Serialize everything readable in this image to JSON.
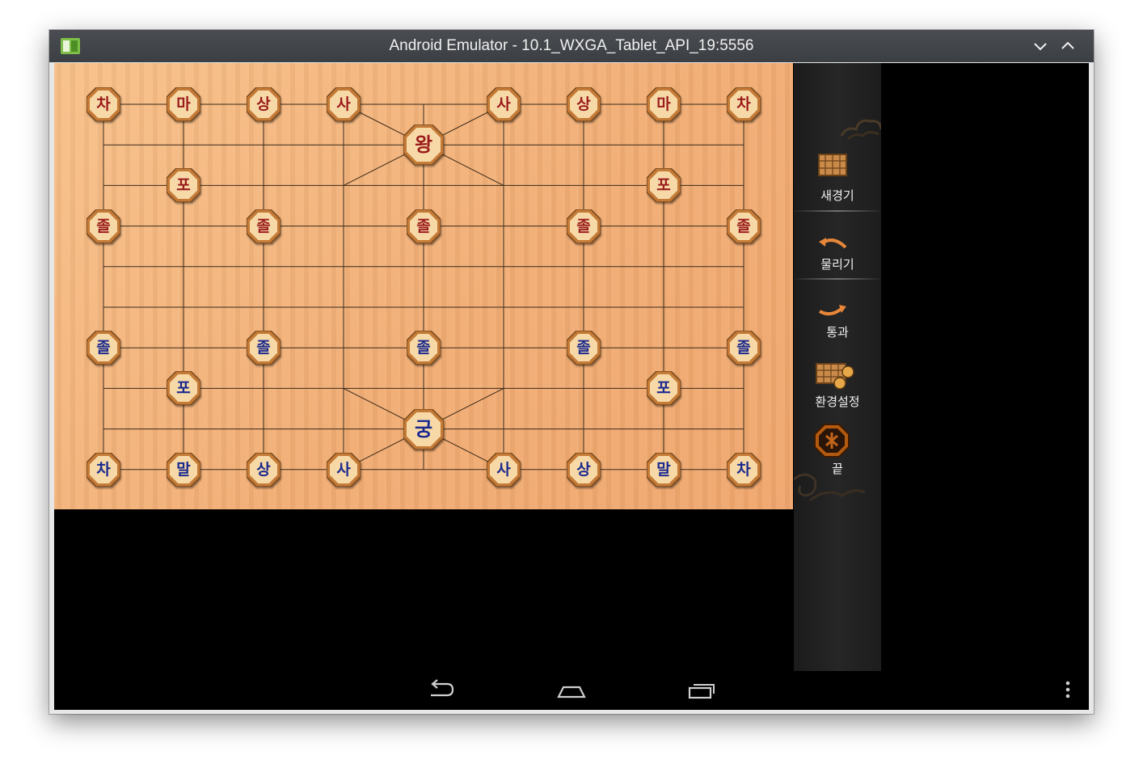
{
  "window": {
    "title": "Android Emulator - 10.1_WXGA_Tablet_API_19:5556"
  },
  "board": {
    "pieces": [
      {
        "label": "차",
        "side": "red",
        "col": 0,
        "row": 0
      },
      {
        "label": "마",
        "side": "red",
        "col": 1,
        "row": 0
      },
      {
        "label": "상",
        "side": "red",
        "col": 2,
        "row": 0
      },
      {
        "label": "사",
        "side": "red",
        "col": 3,
        "row": 0
      },
      {
        "label": "왕",
        "side": "red",
        "col": 4,
        "row": 1,
        "large": true
      },
      {
        "label": "사",
        "side": "red",
        "col": 5,
        "row": 0
      },
      {
        "label": "상",
        "side": "red",
        "col": 6,
        "row": 0
      },
      {
        "label": "마",
        "side": "red",
        "col": 7,
        "row": 0
      },
      {
        "label": "차",
        "side": "red",
        "col": 8,
        "row": 0
      },
      {
        "label": "포",
        "side": "red",
        "col": 1,
        "row": 2
      },
      {
        "label": "포",
        "side": "red",
        "col": 7,
        "row": 2
      },
      {
        "label": "졸",
        "side": "red",
        "col": 0,
        "row": 3
      },
      {
        "label": "졸",
        "side": "red",
        "col": 2,
        "row": 3
      },
      {
        "label": "졸",
        "side": "red",
        "col": 4,
        "row": 3
      },
      {
        "label": "졸",
        "side": "red",
        "col": 6,
        "row": 3
      },
      {
        "label": "졸",
        "side": "red",
        "col": 8,
        "row": 3
      },
      {
        "label": "졸",
        "side": "blue",
        "col": 0,
        "row": 6
      },
      {
        "label": "졸",
        "side": "blue",
        "col": 2,
        "row": 6
      },
      {
        "label": "졸",
        "side": "blue",
        "col": 4,
        "row": 6
      },
      {
        "label": "졸",
        "side": "blue",
        "col": 6,
        "row": 6
      },
      {
        "label": "졸",
        "side": "blue",
        "col": 8,
        "row": 6
      },
      {
        "label": "포",
        "side": "blue",
        "col": 1,
        "row": 7
      },
      {
        "label": "포",
        "side": "blue",
        "col": 7,
        "row": 7
      },
      {
        "label": "궁",
        "side": "blue",
        "col": 4,
        "row": 8,
        "large": true
      },
      {
        "label": "차",
        "side": "blue",
        "col": 0,
        "row": 9
      },
      {
        "label": "말",
        "side": "blue",
        "col": 1,
        "row": 9
      },
      {
        "label": "상",
        "side": "blue",
        "col": 2,
        "row": 9
      },
      {
        "label": "사",
        "side": "blue",
        "col": 3,
        "row": 9
      },
      {
        "label": "사",
        "side": "blue",
        "col": 5,
        "row": 9
      },
      {
        "label": "상",
        "side": "blue",
        "col": 6,
        "row": 9
      },
      {
        "label": "말",
        "side": "blue",
        "col": 7,
        "row": 9
      },
      {
        "label": "차",
        "side": "blue",
        "col": 8,
        "row": 9
      }
    ],
    "colors": {
      "red": "#9a1b1b",
      "blue": "#1b2a8f",
      "line": "#3a2a1a"
    }
  },
  "menu": {
    "new_game": "새경기",
    "undo": "물리기",
    "pass": "통과",
    "settings": "환경설정",
    "exit": "끝"
  },
  "navbar": {
    "back": "back-icon",
    "home": "home-icon",
    "recents": "recents-icon",
    "overflow": "overflow-menu-icon"
  }
}
